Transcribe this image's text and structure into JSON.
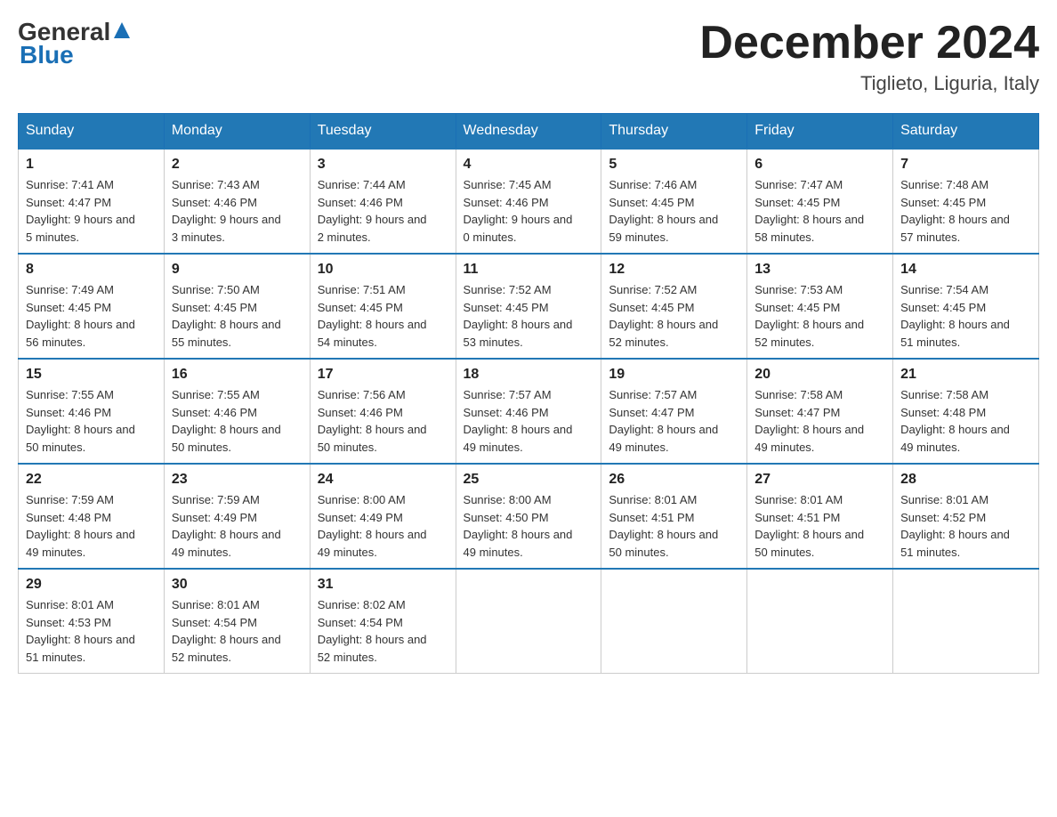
{
  "header": {
    "logo": {
      "general": "General",
      "blue": "Blue"
    },
    "title": "December 2024",
    "location": "Tiglieto, Liguria, Italy"
  },
  "days_of_week": [
    "Sunday",
    "Monday",
    "Tuesday",
    "Wednesday",
    "Thursday",
    "Friday",
    "Saturday"
  ],
  "weeks": [
    [
      {
        "day": 1,
        "sunrise": "7:41 AM",
        "sunset": "4:47 PM",
        "daylight": "9 hours and 5 minutes."
      },
      {
        "day": 2,
        "sunrise": "7:43 AM",
        "sunset": "4:46 PM",
        "daylight": "9 hours and 3 minutes."
      },
      {
        "day": 3,
        "sunrise": "7:44 AM",
        "sunset": "4:46 PM",
        "daylight": "9 hours and 2 minutes."
      },
      {
        "day": 4,
        "sunrise": "7:45 AM",
        "sunset": "4:46 PM",
        "daylight": "9 hours and 0 minutes."
      },
      {
        "day": 5,
        "sunrise": "7:46 AM",
        "sunset": "4:45 PM",
        "daylight": "8 hours and 59 minutes."
      },
      {
        "day": 6,
        "sunrise": "7:47 AM",
        "sunset": "4:45 PM",
        "daylight": "8 hours and 58 minutes."
      },
      {
        "day": 7,
        "sunrise": "7:48 AM",
        "sunset": "4:45 PM",
        "daylight": "8 hours and 57 minutes."
      }
    ],
    [
      {
        "day": 8,
        "sunrise": "7:49 AM",
        "sunset": "4:45 PM",
        "daylight": "8 hours and 56 minutes."
      },
      {
        "day": 9,
        "sunrise": "7:50 AM",
        "sunset": "4:45 PM",
        "daylight": "8 hours and 55 minutes."
      },
      {
        "day": 10,
        "sunrise": "7:51 AM",
        "sunset": "4:45 PM",
        "daylight": "8 hours and 54 minutes."
      },
      {
        "day": 11,
        "sunrise": "7:52 AM",
        "sunset": "4:45 PM",
        "daylight": "8 hours and 53 minutes."
      },
      {
        "day": 12,
        "sunrise": "7:52 AM",
        "sunset": "4:45 PM",
        "daylight": "8 hours and 52 minutes."
      },
      {
        "day": 13,
        "sunrise": "7:53 AM",
        "sunset": "4:45 PM",
        "daylight": "8 hours and 52 minutes."
      },
      {
        "day": 14,
        "sunrise": "7:54 AM",
        "sunset": "4:45 PM",
        "daylight": "8 hours and 51 minutes."
      }
    ],
    [
      {
        "day": 15,
        "sunrise": "7:55 AM",
        "sunset": "4:46 PM",
        "daylight": "8 hours and 50 minutes."
      },
      {
        "day": 16,
        "sunrise": "7:55 AM",
        "sunset": "4:46 PM",
        "daylight": "8 hours and 50 minutes."
      },
      {
        "day": 17,
        "sunrise": "7:56 AM",
        "sunset": "4:46 PM",
        "daylight": "8 hours and 50 minutes."
      },
      {
        "day": 18,
        "sunrise": "7:57 AM",
        "sunset": "4:46 PM",
        "daylight": "8 hours and 49 minutes."
      },
      {
        "day": 19,
        "sunrise": "7:57 AM",
        "sunset": "4:47 PM",
        "daylight": "8 hours and 49 minutes."
      },
      {
        "day": 20,
        "sunrise": "7:58 AM",
        "sunset": "4:47 PM",
        "daylight": "8 hours and 49 minutes."
      },
      {
        "day": 21,
        "sunrise": "7:58 AM",
        "sunset": "4:48 PM",
        "daylight": "8 hours and 49 minutes."
      }
    ],
    [
      {
        "day": 22,
        "sunrise": "7:59 AM",
        "sunset": "4:48 PM",
        "daylight": "8 hours and 49 minutes."
      },
      {
        "day": 23,
        "sunrise": "7:59 AM",
        "sunset": "4:49 PM",
        "daylight": "8 hours and 49 minutes."
      },
      {
        "day": 24,
        "sunrise": "8:00 AM",
        "sunset": "4:49 PM",
        "daylight": "8 hours and 49 minutes."
      },
      {
        "day": 25,
        "sunrise": "8:00 AM",
        "sunset": "4:50 PM",
        "daylight": "8 hours and 49 minutes."
      },
      {
        "day": 26,
        "sunrise": "8:01 AM",
        "sunset": "4:51 PM",
        "daylight": "8 hours and 50 minutes."
      },
      {
        "day": 27,
        "sunrise": "8:01 AM",
        "sunset": "4:51 PM",
        "daylight": "8 hours and 50 minutes."
      },
      {
        "day": 28,
        "sunrise": "8:01 AM",
        "sunset": "4:52 PM",
        "daylight": "8 hours and 51 minutes."
      }
    ],
    [
      {
        "day": 29,
        "sunrise": "8:01 AM",
        "sunset": "4:53 PM",
        "daylight": "8 hours and 51 minutes."
      },
      {
        "day": 30,
        "sunrise": "8:01 AM",
        "sunset": "4:54 PM",
        "daylight": "8 hours and 52 minutes."
      },
      {
        "day": 31,
        "sunrise": "8:02 AM",
        "sunset": "4:54 PM",
        "daylight": "8 hours and 52 minutes."
      },
      null,
      null,
      null,
      null
    ]
  ]
}
